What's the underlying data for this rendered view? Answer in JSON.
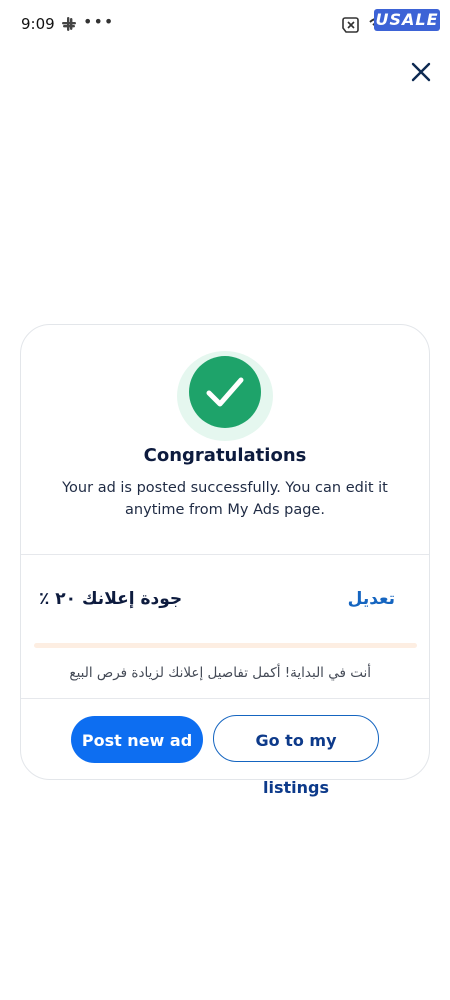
{
  "status_bar": {
    "time": "9:09",
    "more": "•••",
    "icons": [
      "slack-icon",
      "no-sim-icon",
      "wifi-icon"
    ]
  },
  "watermark": {
    "logo_text": "USALE"
  },
  "header": {
    "close_icon": "close-icon"
  },
  "success": {
    "icon": "checkmark-icon",
    "title": "Congratulations",
    "message": "Your ad is posted successfully. You can edit it anytime from My Ads page."
  },
  "ad_quality": {
    "label": "جودة إعلانك ٢٠ ٪",
    "percent": 20,
    "edit_label": "تعديل",
    "tip": "أنت في البداية! أكمل تفاصيل إعلانك لزيادة فرص البيع"
  },
  "actions": {
    "post_new_ad": "Post new ad",
    "go_to_listings": "Go to my listings"
  },
  "colors": {
    "primary": "#0d6ef1",
    "success": "#1ea36a",
    "link": "#1565c0",
    "progress": "#f5a25d"
  }
}
